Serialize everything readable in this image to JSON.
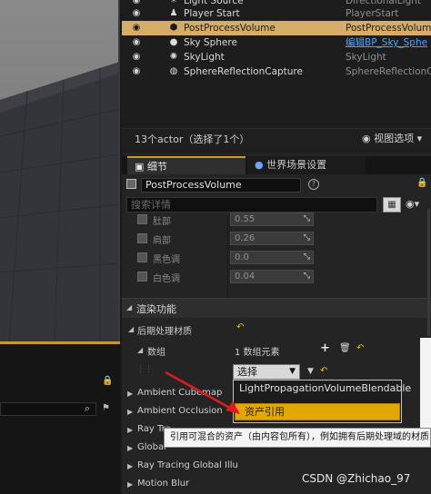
{
  "outliner": {
    "rows": [
      {
        "name": "Light Source",
        "type": "DirectionalLight",
        "icon": "light-icon"
      },
      {
        "name": "Player Start",
        "type": "PlayerStart",
        "icon": "player-start-icon"
      },
      {
        "name": "PostProcessVolume",
        "type": "PostProcessVolum",
        "icon": "volume-icon",
        "selected": true
      },
      {
        "name": "Sky Sphere",
        "type": "编辑BP_Sky_Sphe",
        "icon": "sphere-icon",
        "type_is_link": true
      },
      {
        "name": "SkyLight",
        "type": "SkyLight",
        "icon": "skylight-icon"
      },
      {
        "name": "SphereReflectionCapture",
        "type": "SphereReflectionCapt",
        "icon": "reflection-icon"
      }
    ],
    "actor_count": "13个actor（选择了1个）",
    "view_options": "视图选项"
  },
  "details": {
    "tab_details": "细节",
    "tab_world_settings": "世界场景设置",
    "object_name": "PostProcessVolume",
    "search_placeholder": "搜索详情",
    "props": [
      {
        "label": "肚部",
        "value": "0.55"
      },
      {
        "label": "肩部",
        "value": "0.26"
      },
      {
        "label": "黑色调",
        "value": "0.0"
      },
      {
        "label": "白色调",
        "value": "0.04"
      }
    ],
    "category_render": "渲染功能",
    "post_process_materials": "后期处理材质",
    "array_label": "数组",
    "array_count": "1 数组元素",
    "select_label": "选择",
    "sections": [
      "Ambient Cubemap",
      "Ambient Occlusion",
      "Ray Tra",
      "Global",
      "Ray Tracing Global Illu",
      "Motion Blur"
    ]
  },
  "dropdown": {
    "option1": "LightPropagationVolumeBlendable",
    "option2": "资产引用"
  },
  "tooltip": "引用可混合的资产（由内容包所有），例如拥有后期处理域的材质",
  "watermark": "CSDN @Zhichao_97",
  "colors": {
    "selection": "#d6ad68",
    "highlight": "#e0a800",
    "arrow": "#e01b1b",
    "link": "#4da3ff"
  }
}
